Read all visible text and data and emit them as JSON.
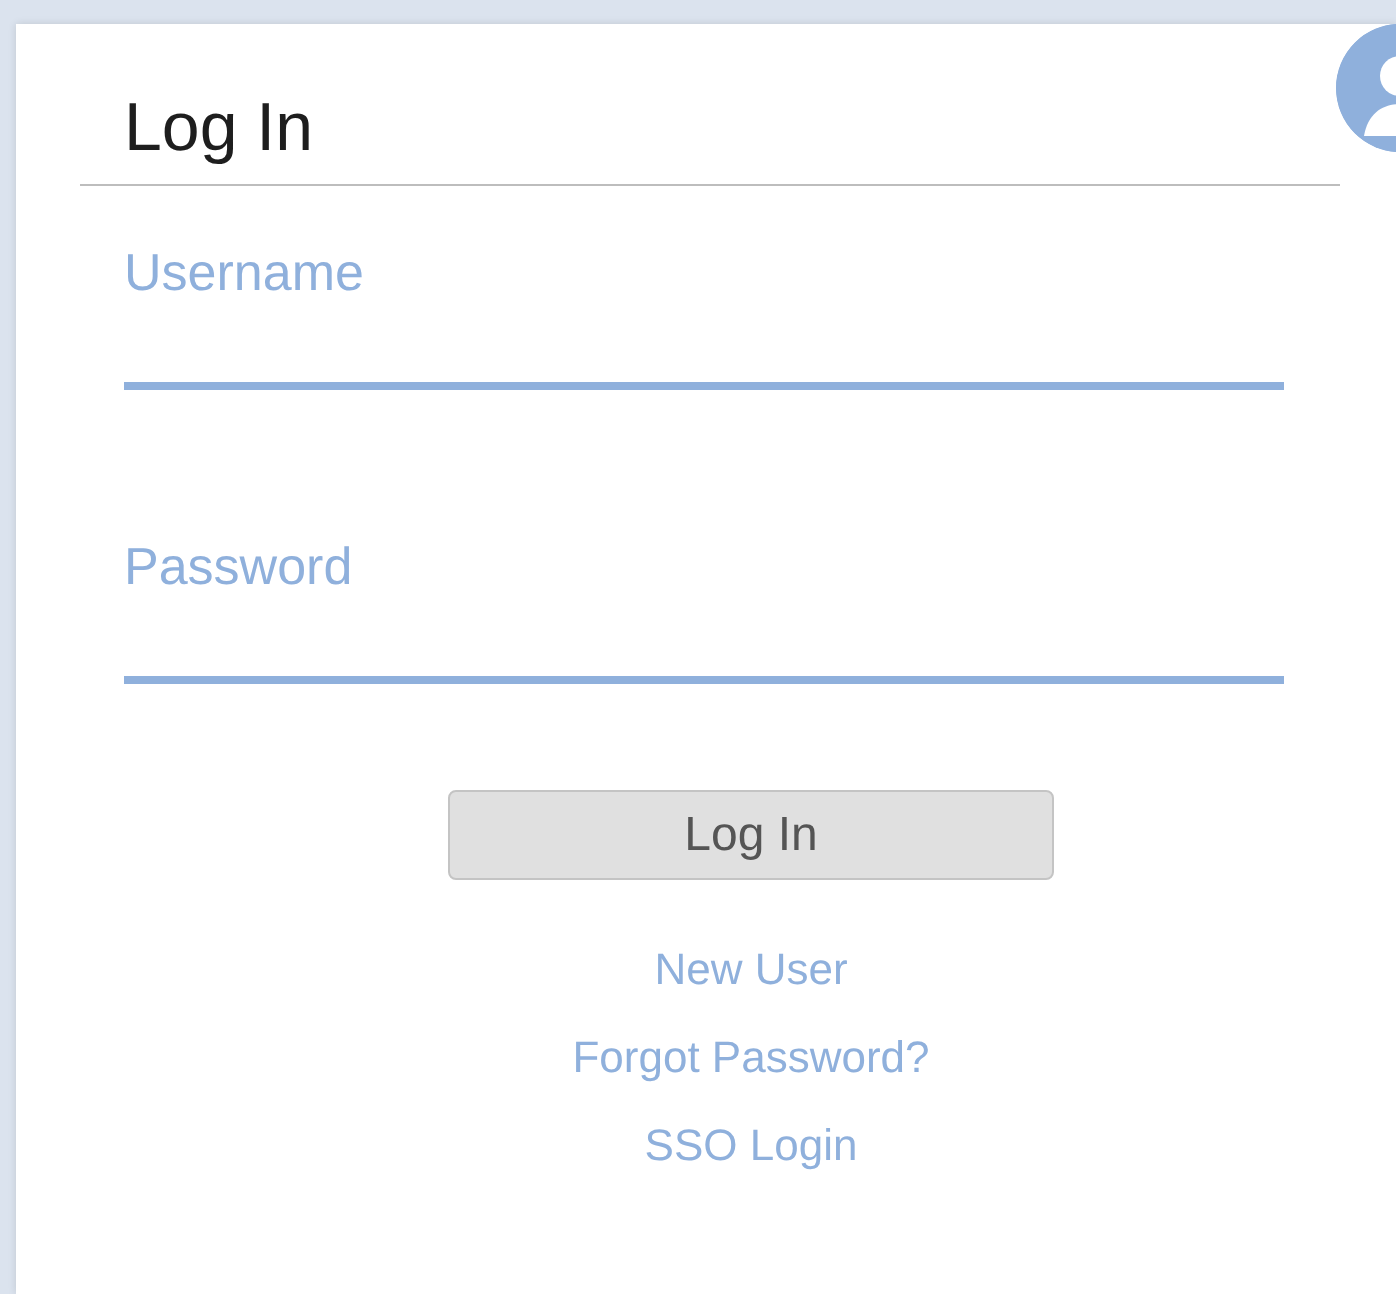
{
  "title": "Log In",
  "fields": [
    {
      "label": "Username"
    },
    {
      "label": "Password"
    }
  ],
  "submit": "Log In",
  "links": [
    "New User",
    "Forgot Password?",
    "SSO Login"
  ]
}
